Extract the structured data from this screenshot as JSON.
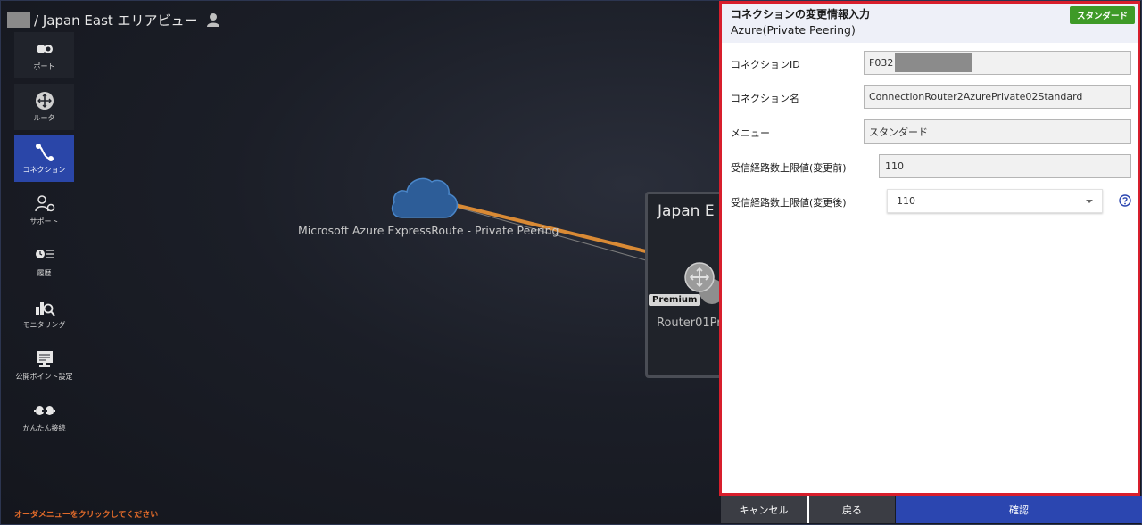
{
  "header": {
    "title": "/ Japan East エリアビュー"
  },
  "sidebar": {
    "items": [
      {
        "label": "ポート",
        "icon": "port-icon"
      },
      {
        "label": "ルータ",
        "icon": "router-icon"
      },
      {
        "label": "コネクション",
        "icon": "connection-icon",
        "active": true
      },
      {
        "label": "サポート",
        "icon": "support-icon"
      },
      {
        "label": "履歴",
        "icon": "history-icon"
      },
      {
        "label": "モニタリング",
        "icon": "monitoring-icon"
      },
      {
        "label": "公開ポイント設定",
        "icon": "public-point-icon"
      },
      {
        "label": "かんたん接続",
        "icon": "easy-connect-icon"
      }
    ],
    "hint": "オーダメニューをクリックしてください"
  },
  "diagram": {
    "cloud_label": "Microsoft Azure ExpressRoute - Private Peering",
    "area_title": "Japan E",
    "premium_badge": "Premium",
    "router_label": "Router01Pr"
  },
  "panel": {
    "title": "コネクションの変更情報入力",
    "subtitle": "Azure(Private Peering)",
    "plan_badge": "スタンダード",
    "fields": {
      "connection_id": {
        "label": "コネクションID",
        "value": "F032"
      },
      "connection_name": {
        "label": "コネクション名",
        "value": "ConnectionRouter2AzurePrivate02Standard"
      },
      "menu": {
        "label": "メニュー",
        "value": "スタンダード"
      },
      "route_limit_before": {
        "label": "受信経路数上限値(変更前)",
        "value": "110"
      },
      "route_limit_after": {
        "label": "受信経路数上限値(変更後)",
        "value": "110"
      }
    }
  },
  "buttons": {
    "cancel": "キャンセル",
    "back": "戻る",
    "confirm": "確認"
  },
  "colors": {
    "accent_blue": "#2b46b0",
    "panel_border": "#d81e2c",
    "badge_green": "#3e9a27",
    "connection_line": "#d98a35"
  }
}
